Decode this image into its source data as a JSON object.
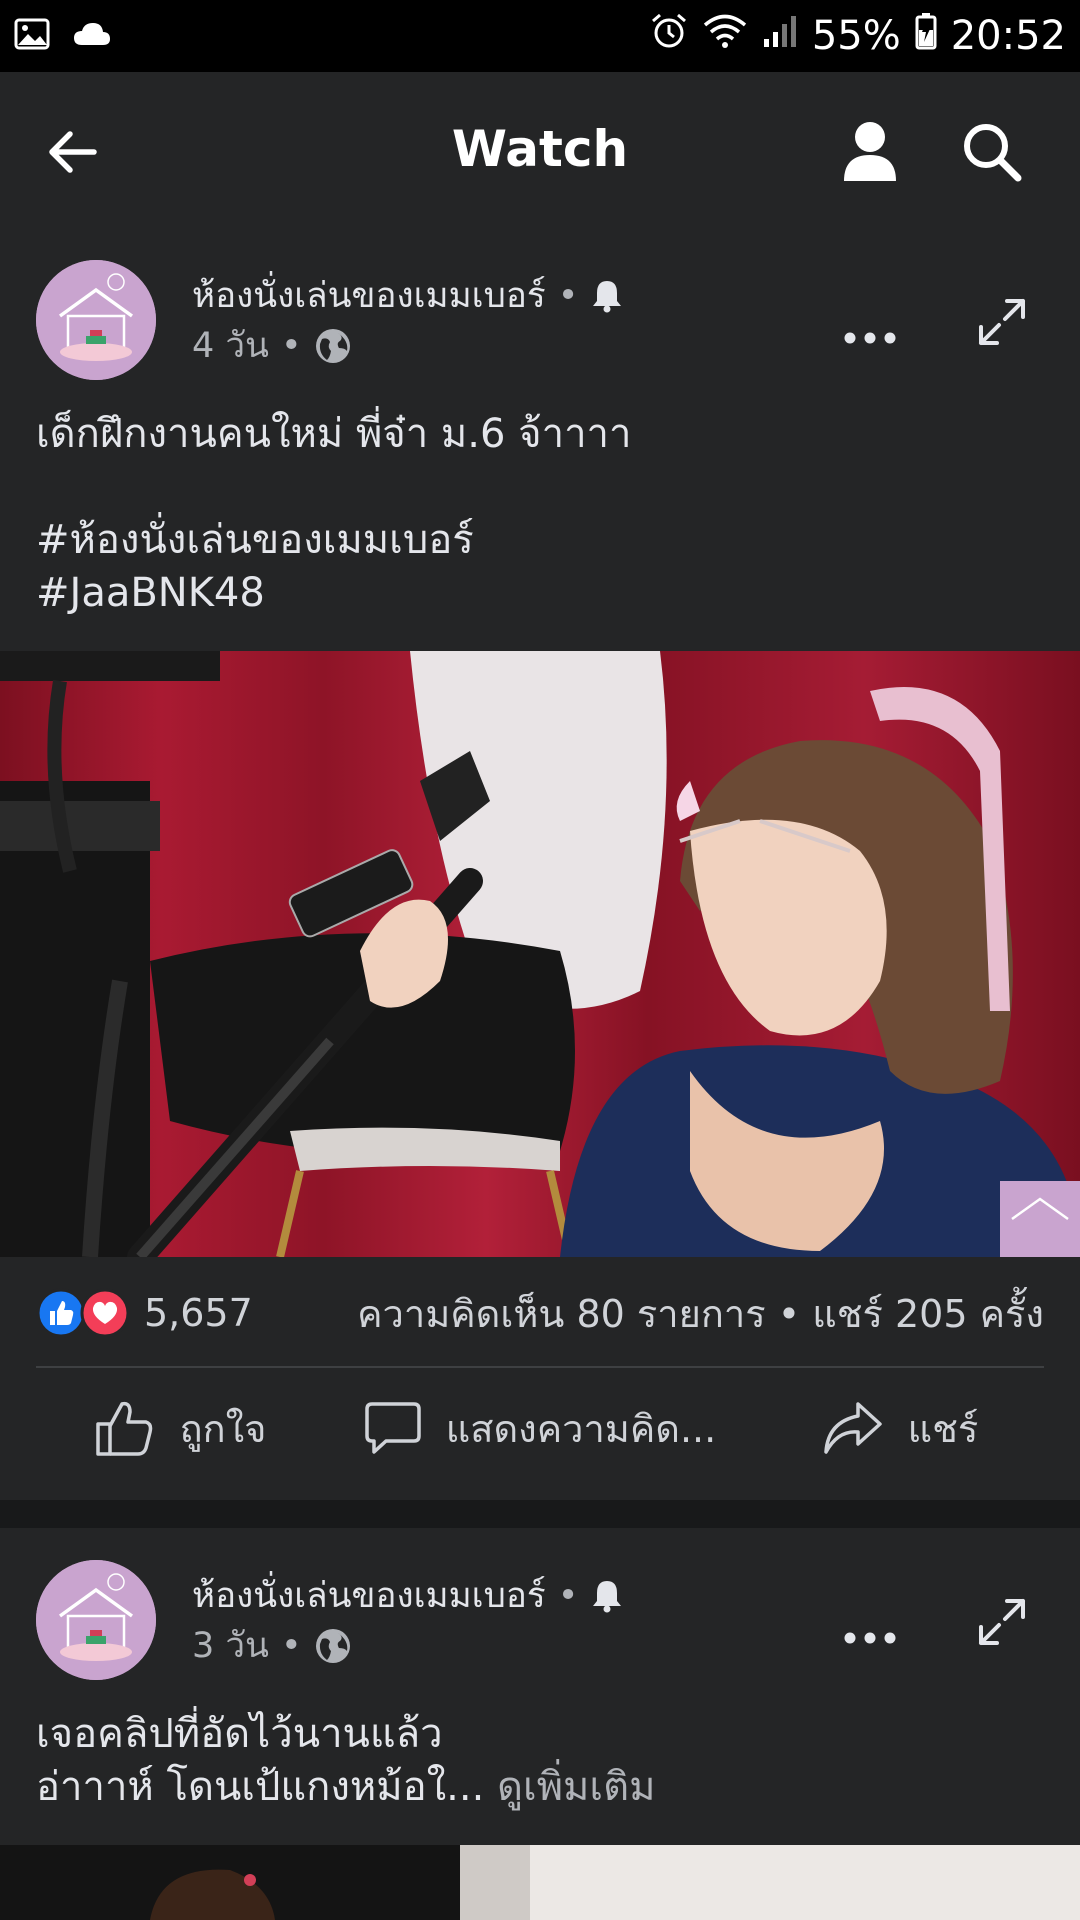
{
  "status_bar": {
    "battery": "55%",
    "time": "20:52",
    "icons": [
      "gallery-icon",
      "cloud-icon",
      "alarm-icon",
      "wifi-icon",
      "signal-icon",
      "battery-icon"
    ]
  },
  "header": {
    "title": "Watch",
    "icons": [
      "back-arrow-icon",
      "profile-icon",
      "search-icon"
    ]
  },
  "posts": [
    {
      "page_name": "ห้องนั่งเล่นของเมมเบอร์",
      "time": "4 วัน",
      "text": "เด็กฝึกงานคนใหม่ พี่จ๋า ม.6 จ้าาาา\n\n#ห้องนั่งเล่นของเมมเบอร์\n#JaaBNK48",
      "reaction_count": "5,657",
      "comments_shares": "ความคิดเห็น 80 รายการ • แชร์ 205 ครั้ง",
      "actions": {
        "like": "ถูกใจ",
        "comment": "แสดงความคิด...",
        "share": "แชร์"
      }
    },
    {
      "page_name": "ห้องนั่งเล่นของเมมเบอร์",
      "time": "3 วัน",
      "text": "เจอคลิปที่อัดไว้นานแล้ว\nอ่าาาห์ โดนเป้แกงหม้อใ...",
      "see_more": " ดูเพิ่มเติม"
    }
  ],
  "colors": {
    "background": "#18191a",
    "surface": "#242526",
    "text": "#e4e6eb",
    "secondary_text": "#b0b3b8",
    "like_blue": "#1877f2",
    "love_red": "#f33e58"
  }
}
